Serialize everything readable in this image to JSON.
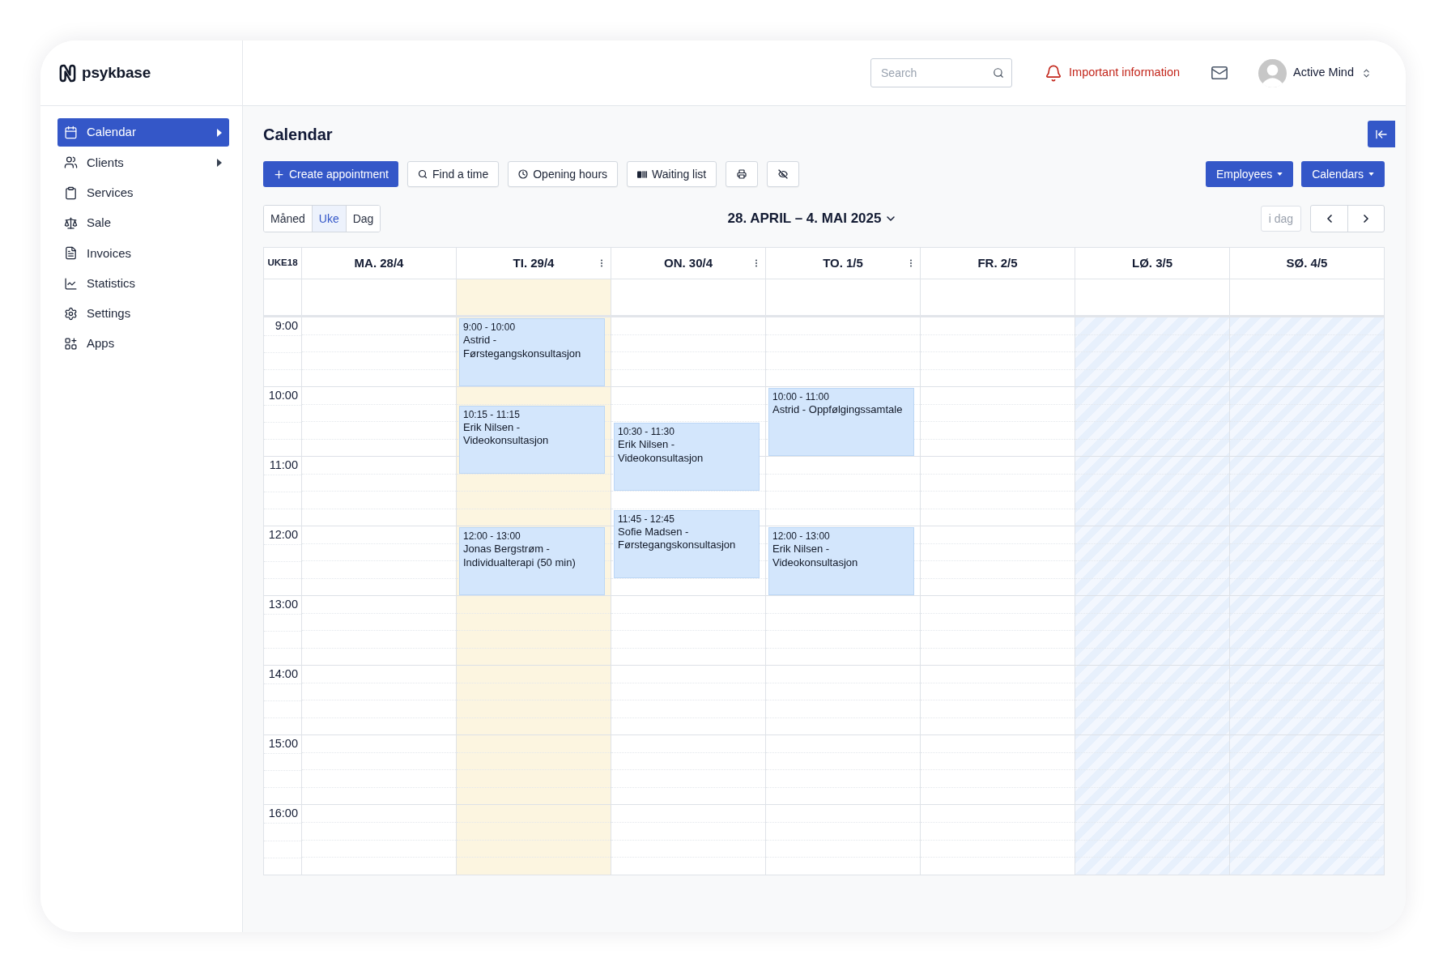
{
  "sidebar": {
    "logo": "psykbase",
    "items": [
      {
        "label": "Calendar",
        "selected": true,
        "submenu": true
      },
      {
        "label": "Clients",
        "selected": false,
        "submenu": true
      },
      {
        "label": "Services",
        "selected": false,
        "submenu": false
      },
      {
        "label": "Sale",
        "selected": false,
        "submenu": false
      },
      {
        "label": "Invoices",
        "selected": false,
        "submenu": false
      },
      {
        "label": "Statistics",
        "selected": false,
        "submenu": false
      },
      {
        "label": "Settings",
        "selected": false,
        "submenu": false
      },
      {
        "label": "Apps",
        "selected": false,
        "submenu": false
      }
    ]
  },
  "header": {
    "search": {
      "placeholder": "Search"
    },
    "alert": "Important information",
    "user": {
      "name": "Active Mind"
    }
  },
  "page": {
    "title": "Calendar"
  },
  "toolbar": {
    "actions": [
      {
        "kind": "primary",
        "label": "Create appointment"
      },
      {
        "kind": "secondary",
        "label": "Find a time"
      },
      {
        "kind": "secondary",
        "label": "Opening hours"
      },
      {
        "kind": "secondary",
        "label": "Waiting list"
      },
      {
        "kind": "icon"
      },
      {
        "kind": "icon"
      }
    ],
    "filters": [
      {
        "label": "Employees"
      },
      {
        "label": "Calendars"
      }
    ]
  },
  "navigation": {
    "views": [
      {
        "label": "Måned",
        "selected": false
      },
      {
        "label": "Uke",
        "selected": true
      },
      {
        "label": "Dag",
        "selected": false
      }
    ],
    "range": "28. APRIL – 4. MAI 2025",
    "today": {
      "label": "i dag",
      "disabled": true
    }
  },
  "calendar": {
    "week": "UKE18",
    "hours": [
      "9:00",
      "10:00",
      "11:00",
      "12:00",
      "13:00",
      "14:00",
      "15:00",
      "16:00"
    ],
    "days": [
      {
        "label": "MA. 28/4",
        "today": false,
        "closed": false,
        "menu": false
      },
      {
        "label": "TI. 29/4",
        "today": true,
        "closed": false,
        "menu": true,
        "events": [
          {
            "time": "9:00 - 10:00",
            "title": "Astrid - Førstegangskonsultasjon"
          },
          {
            "time": "10:15 - 11:15",
            "title": "Erik Nilsen - Videokonsultasjon"
          },
          {
            "time": "12:00 - 13:00",
            "title": "Jonas Bergstrøm - Individualterapi (50 min)"
          }
        ]
      },
      {
        "label": "ON. 30/4",
        "today": false,
        "closed": false,
        "menu": true,
        "events": [
          {
            "time": "10:30 - 11:30",
            "title": "Erik Nilsen - Videokonsultasjon"
          },
          {
            "time": "11:45 - 12:45",
            "title": "Sofie Madsen - Førstegangskonsultasjon"
          }
        ]
      },
      {
        "label": "TO. 1/5",
        "today": false,
        "closed": false,
        "menu": true,
        "events": [
          {
            "time": "10:00 - 11:00",
            "title": "Astrid - Oppfølgingssamtale"
          },
          {
            "time": "12:00 - 13:00",
            "title": "Erik Nilsen - Videokonsultasjon"
          }
        ]
      },
      {
        "label": "FR. 2/5",
        "today": false,
        "closed": false,
        "menu": false
      },
      {
        "label": "LØ. 3/5",
        "today": false,
        "closed": true,
        "menu": false
      },
      {
        "label": "SØ. 4/5",
        "today": false,
        "closed": true,
        "menu": false
      }
    ]
  }
}
